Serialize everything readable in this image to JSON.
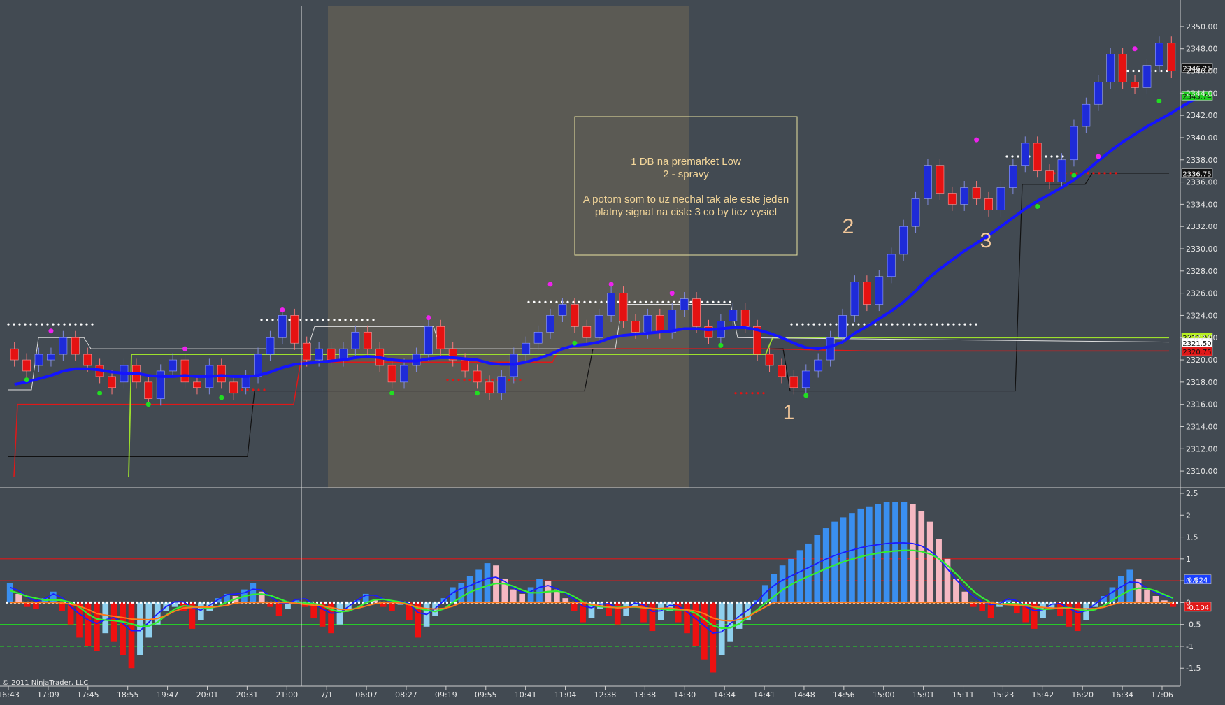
{
  "copyright": "© 2011 NinjaTrader, LLC",
  "note": {
    "lines": [
      "1 DB na premarket Low",
      "2 - spravy",
      "",
      "A potom som to uz nechal tak ale este jeden",
      "platny signal na cisle 3 co by tiez vysiel"
    ]
  },
  "annotations": [
    {
      "text": "1",
      "x_time_index": 40.8,
      "price": 2315.8
    },
    {
      "text": "2",
      "x_time_index": 44.3,
      "price": 2332.2
    },
    {
      "text": "3",
      "x_time_index": 51.4,
      "price": 2330.6
    }
  ],
  "colors": {
    "background": "#424a52",
    "session_shade": "#5b5a54",
    "up_candle": "#1e2bd8",
    "down_candle": "#e51212",
    "ema": "#1414ff",
    "red_line": "#e01818",
    "lime_line": "#9de02c",
    "black_line": "#111111",
    "white_dots": "#ffffff",
    "magenta_dot": "#ee22ee",
    "green_dot": "#22dd22"
  },
  "price_badges": [
    {
      "text": "2346.25",
      "price": 2346.25,
      "bg": "#111111",
      "fg": "#ffffff"
    },
    {
      "text": "2343.74",
      "price": 2343.74,
      "bg": "#22cc22",
      "fg": "#111111"
    },
    {
      "text": "2336.75",
      "price": 2336.75,
      "bg": "#111111",
      "fg": "#ffffff"
    },
    {
      "text": "2322.00",
      "price": 2322.0,
      "bg": "#b7f020",
      "fg": "#111111"
    },
    {
      "text": "2321.50",
      "price": 2321.5,
      "bg": "#ffffff",
      "fg": "#111111"
    },
    {
      "text": "2320.75",
      "price": 2320.75,
      "bg": "#e01818",
      "fg": "#111111"
    }
  ],
  "osc_badges": [
    {
      "text": "0.524",
      "value": 0.524,
      "bg": "#1a40ff",
      "fg": "#ffffff"
    },
    {
      "text": "-0.104",
      "value": -0.104,
      "bg": "#e01818",
      "fg": "#ffffff"
    }
  ],
  "chart_data": [
    {
      "type": "candlestick",
      "ylim": [
        2309,
        2351
      ],
      "y_ticks": [
        "2350.00",
        "2348.00",
        "2346.00",
        "2344.00",
        "2342.00",
        "2340.00",
        "2338.00",
        "2336.00",
        "2334.00",
        "2332.00",
        "2330.00",
        "2328.00",
        "2326.00",
        "2324.00",
        "2322.00",
        "2320.00",
        "2318.00",
        "2316.00",
        "2314.00",
        "2312.00",
        "2310.00"
      ],
      "x_ticks": [
        "16:43",
        "17:09",
        "17:45",
        "18:55",
        "19:47",
        "20:01",
        "20:31",
        "21:00",
        "7/1",
        "06:07",
        "08:27",
        "09:19",
        "09:55",
        "10:41",
        "11:04",
        "12:38",
        "13:38",
        "14:30",
        "14:34",
        "14:41",
        "14:48",
        "14:56",
        "15:00",
        "15:01",
        "15:11",
        "15:23",
        "15:42",
        "16:20",
        "16:34",
        "17:06"
      ],
      "candles": [
        {
          "o": 2321.0,
          "c": 2320.0
        },
        {
          "o": 2320.0,
          "c": 2319.0
        },
        {
          "o": 2319.5,
          "c": 2320.5
        },
        {
          "o": 2320.0,
          "c": 2320.5
        },
        {
          "o": 2320.5,
          "c": 2322.0
        },
        {
          "o": 2322.0,
          "c": 2320.5
        },
        {
          "o": 2320.5,
          "c": 2319.5
        },
        {
          "o": 2319.5,
          "c": 2318.5
        },
        {
          "o": 2318.5,
          "c": 2317.5
        },
        {
          "o": 2318.0,
          "c": 2319.5
        },
        {
          "o": 2319.5,
          "c": 2318.0
        },
        {
          "o": 2318.0,
          "c": 2316.5
        },
        {
          "o": 2316.5,
          "c": 2319.0
        },
        {
          "o": 2319.0,
          "c": 2320.0
        },
        {
          "o": 2320.0,
          "c": 2318.0
        },
        {
          "o": 2318.0,
          "c": 2317.5
        },
        {
          "o": 2317.5,
          "c": 2319.5
        },
        {
          "o": 2319.5,
          "c": 2318.0
        },
        {
          "o": 2318.0,
          "c": 2317.0
        },
        {
          "o": 2317.5,
          "c": 2318.5
        },
        {
          "o": 2318.5,
          "c": 2320.5
        },
        {
          "o": 2320.5,
          "c": 2322.0
        },
        {
          "o": 2322.0,
          "c": 2324.0
        },
        {
          "o": 2324.0,
          "c": 2321.5
        },
        {
          "o": 2321.5,
          "c": 2320.0
        },
        {
          "o": 2320.0,
          "c": 2321.0
        },
        {
          "o": 2321.0,
          "c": 2320.0
        },
        {
          "o": 2320.0,
          "c": 2321.0
        },
        {
          "o": 2321.0,
          "c": 2322.5
        },
        {
          "o": 2322.5,
          "c": 2321.0
        },
        {
          "o": 2321.0,
          "c": 2319.5
        },
        {
          "o": 2319.5,
          "c": 2318.0
        },
        {
          "o": 2318.0,
          "c": 2319.5
        },
        {
          "o": 2319.5,
          "c": 2320.5
        },
        {
          "o": 2320.5,
          "c": 2323.0
        },
        {
          "o": 2323.0,
          "c": 2321.0
        },
        {
          "o": 2321.0,
          "c": 2320.0
        },
        {
          "o": 2320.0,
          "c": 2319.0
        },
        {
          "o": 2319.0,
          "c": 2318.0
        },
        {
          "o": 2318.0,
          "c": 2317.0
        },
        {
          "o": 2317.0,
          "c": 2318.5
        },
        {
          "o": 2318.5,
          "c": 2320.5
        },
        {
          "o": 2320.5,
          "c": 2321.5
        },
        {
          "o": 2321.5,
          "c": 2322.5
        },
        {
          "o": 2322.5,
          "c": 2324.0
        },
        {
          "o": 2324.0,
          "c": 2325.0
        },
        {
          "o": 2325.0,
          "c": 2323.0
        },
        {
          "o": 2323.0,
          "c": 2322.0
        },
        {
          "o": 2322.0,
          "c": 2324.0
        },
        {
          "o": 2324.0,
          "c": 2326.0
        },
        {
          "o": 2326.0,
          "c": 2323.5
        },
        {
          "o": 2323.5,
          "c": 2322.5
        },
        {
          "o": 2322.5,
          "c": 2324.0
        },
        {
          "o": 2324.0,
          "c": 2322.5
        },
        {
          "o": 2322.5,
          "c": 2324.5
        },
        {
          "o": 2324.5,
          "c": 2325.5
        },
        {
          "o": 2325.5,
          "c": 2323.0
        },
        {
          "o": 2323.0,
          "c": 2322.0
        },
        {
          "o": 2322.0,
          "c": 2323.5
        },
        {
          "o": 2323.5,
          "c": 2324.5
        },
        {
          "o": 2324.5,
          "c": 2323.0
        },
        {
          "o": 2323.0,
          "c": 2320.5
        },
        {
          "o": 2320.5,
          "c": 2319.5
        },
        {
          "o": 2319.5,
          "c": 2318.5
        },
        {
          "o": 2318.5,
          "c": 2317.5
        },
        {
          "o": 2317.5,
          "c": 2319.0
        },
        {
          "o": 2319.0,
          "c": 2320.0
        },
        {
          "o": 2320.0,
          "c": 2322.0
        },
        {
          "o": 2322.0,
          "c": 2324.0
        },
        {
          "o": 2324.0,
          "c": 2327.0
        },
        {
          "o": 2327.0,
          "c": 2325.0
        },
        {
          "o": 2325.0,
          "c": 2327.5
        },
        {
          "o": 2327.5,
          "c": 2329.5
        },
        {
          "o": 2329.5,
          "c": 2332.0
        },
        {
          "o": 2332.0,
          "c": 2334.5
        },
        {
          "o": 2334.5,
          "c": 2337.5
        },
        {
          "o": 2337.5,
          "c": 2335.0
        },
        {
          "o": 2335.0,
          "c": 2334.0
        },
        {
          "o": 2334.0,
          "c": 2335.5
        },
        {
          "o": 2335.5,
          "c": 2334.5
        },
        {
          "o": 2334.5,
          "c": 2333.5
        },
        {
          "o": 2333.5,
          "c": 2335.5
        },
        {
          "o": 2335.5,
          "c": 2337.5
        },
        {
          "o": 2337.5,
          "c": 2339.5
        },
        {
          "o": 2339.5,
          "c": 2337.0
        },
        {
          "o": 2337.0,
          "c": 2336.0
        },
        {
          "o": 2336.0,
          "c": 2338.0
        },
        {
          "o": 2338.0,
          "c": 2341.0
        },
        {
          "o": 2341.0,
          "c": 2343.0
        },
        {
          "o": 2343.0,
          "c": 2345.0
        },
        {
          "o": 2345.0,
          "c": 2347.5
        },
        {
          "o": 2347.5,
          "c": 2345.0
        },
        {
          "o": 2345.0,
          "c": 2344.5
        },
        {
          "o": 2344.5,
          "c": 2346.5
        },
        {
          "o": 2346.5,
          "c": 2348.5
        },
        {
          "o": 2348.5,
          "c": 2346.0
        }
      ],
      "ema": [
        2317.8,
        2318.0,
        2318.3,
        2318.6,
        2319.0,
        2319.2,
        2319.2,
        2319.1,
        2318.9,
        2318.8,
        2318.8,
        2318.6,
        2318.5,
        2318.5,
        2318.6,
        2318.5,
        2318.5,
        2318.6,
        2318.5,
        2318.5,
        2318.6,
        2318.9,
        2319.3,
        2319.6,
        2319.7,
        2319.8,
        2319.9,
        2320.0,
        2320.2,
        2320.3,
        2320.2,
        2320.0,
        2319.9,
        2319.9,
        2320.1,
        2320.2,
        2320.2,
        2320.1,
        2320.0,
        2319.7,
        2319.6,
        2319.6,
        2319.8,
        2320.1,
        2320.5,
        2321.0,
        2321.3,
        2321.4,
        2321.6,
        2322.0,
        2322.2,
        2322.3,
        2322.4,
        2322.5,
        2322.6,
        2322.8,
        2322.8,
        2322.7,
        2322.8,
        2322.9,
        2322.9,
        2322.7,
        2322.4,
        2322.0,
        2321.5,
        2321.1,
        2321.0,
        2321.2,
        2321.6,
        2322.4,
        2323.0,
        2323.7,
        2324.4,
        2325.2,
        2326.2,
        2327.3,
        2328.2,
        2329.0,
        2329.8,
        2330.5,
        2331.2,
        2332.0,
        2332.8,
        2333.6,
        2334.3,
        2334.9,
        2335.5,
        2336.2,
        2337.0,
        2337.9,
        2338.8,
        2339.6,
        2340.3,
        2341.0,
        2341.6,
        2342.2,
        2342.9,
        2343.5
      ]
    },
    {
      "type": "bar",
      "name": "",
      "ylim": [
        -1.8,
        2.5
      ],
      "y_ticks": [
        "2.5",
        "2",
        "1.5",
        "1",
        "0.5",
        "0",
        "-0.5",
        "-1",
        "-1.5"
      ],
      "values": [
        0.45,
        0.2,
        -0.1,
        -0.15,
        0.1,
        0.25,
        -0.2,
        -0.5,
        -0.8,
        -1.0,
        -1.1,
        -0.7,
        -0.9,
        -1.2,
        -1.5,
        -1.2,
        -0.8,
        -0.5,
        -0.2,
        -0.1,
        -0.2,
        -0.6,
        -0.4,
        -0.2,
        0.1,
        0.2,
        0.15,
        0.3,
        0.45,
        0.25,
        -0.1,
        -0.3,
        -0.15,
        0.05,
        -0.1,
        -0.35,
        -0.55,
        -0.7,
        -0.5,
        -0.2,
        0.05,
        0.2,
        0.05,
        -0.1,
        -0.2,
        -0.05,
        -0.4,
        -0.8,
        -0.55,
        -0.3,
        0.1,
        0.35,
        0.45,
        0.6,
        0.75,
        0.9,
        0.85,
        0.55,
        0.3,
        0.2,
        0.35,
        0.55,
        0.5,
        0.3,
        0.1,
        -0.2,
        -0.45,
        -0.35,
        -0.15,
        -0.3,
        -0.5,
        -0.3,
        -0.1,
        -0.45,
        -0.65,
        -0.4,
        -0.2,
        -0.45,
        -0.7,
        -1.0,
        -1.3,
        -1.6,
        -1.2,
        -0.9,
        -0.6,
        -0.4,
        0.05,
        0.4,
        0.65,
        0.85,
        1.0,
        1.2,
        1.35,
        1.55,
        1.7,
        1.85,
        1.95,
        2.05,
        2.15,
        2.2,
        2.25,
        2.3,
        2.3,
        2.3,
        2.25,
        2.1,
        1.85,
        1.45,
        1.0,
        0.55,
        0.25,
        -0.1,
        -0.2,
        -0.35,
        -0.1,
        0.05,
        -0.25,
        -0.45,
        -0.6,
        -0.35,
        -0.15,
        -0.3,
        -0.55,
        -0.65,
        -0.4,
        -0.1,
        0.15,
        0.35,
        0.6,
        0.75,
        0.55,
        0.3,
        0.15,
        0.05,
        -0.1
      ]
    }
  ]
}
